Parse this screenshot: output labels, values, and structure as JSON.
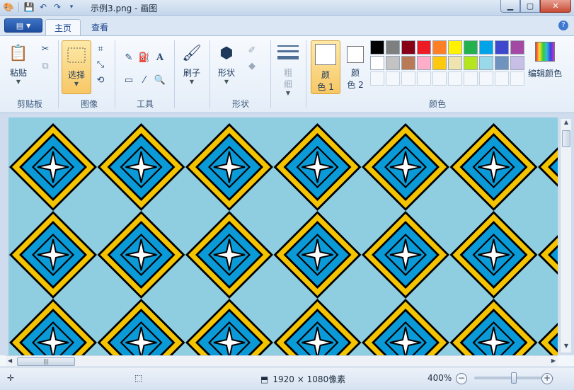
{
  "titlebar": {
    "title": "示例3.png - 画图"
  },
  "tabs": [
    {
      "label": "主页",
      "active": true
    },
    {
      "label": "查看",
      "active": false
    }
  ],
  "ribbon": {
    "clipboard": {
      "group_label": "剪贴板",
      "paste_label": "粘贴"
    },
    "image": {
      "group_label": "图像",
      "select_label": "选择"
    },
    "tools": {
      "group_label": "工具"
    },
    "brush": {
      "label": "刷子"
    },
    "shapes": {
      "group_label": "形状",
      "shapes_label": "形状"
    },
    "size": {
      "label_line1": "粗",
      "label_line2": "细"
    },
    "colors": {
      "group_label": "颜色",
      "color1_line1": "颜",
      "color1_line2": "色 1",
      "color2_line1": "颜",
      "color2_line2": "色 2",
      "edit_colors_label": "编辑颜色",
      "palette_row1": [
        "#000000",
        "#7f7f7f",
        "#880015",
        "#ed1c24",
        "#ff7f27",
        "#fff200",
        "#22b14c",
        "#00a2e8",
        "#3f48cc",
        "#a349a4"
      ],
      "palette_row2": [
        "#ffffff",
        "#c3c3c3",
        "#b97a57",
        "#ffaec9",
        "#ffc90e",
        "#efe4b0",
        "#b5e61d",
        "#99d9ea",
        "#7092be",
        "#c8bfe7"
      ]
    }
  },
  "canvas": {
    "pattern_colors": {
      "background": "#8fcde0",
      "diamond_outline": "#000000",
      "diamond_gold": "#f5c400",
      "diamond_blue": "#0a9ad8",
      "star": "#ffffff"
    }
  },
  "statusbar": {
    "dimensions": "1920 × 1080像素",
    "zoom": "400%",
    "zoom_level_fraction": 0.5
  }
}
